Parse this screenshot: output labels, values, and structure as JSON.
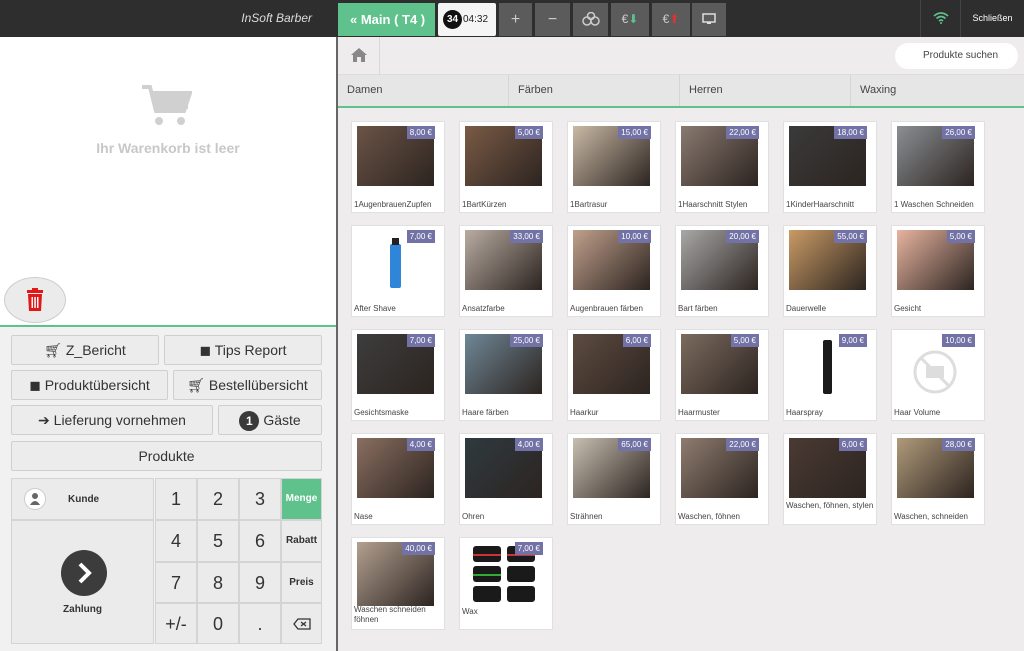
{
  "header": {
    "brand": "InSoft Barber",
    "main_tab": "« Main ( T4 )",
    "clock_badge": "34",
    "clock_time": "04:32",
    "tool_icons": [
      "plus-icon",
      "minus-icon",
      "split-icon",
      "euro-in-icon",
      "euro-out-icon",
      "monitor-icon"
    ],
    "close_label": "Schließen"
  },
  "cart": {
    "empty_text": "Ihr Warenkorb ist leer"
  },
  "actions": {
    "z_report": "Z_Bericht",
    "tips_report": "Tips Report",
    "product_overview": "Produktübersicht",
    "order_overview": "Bestellübersicht",
    "delivery": "Lieferung vornehmen",
    "guests_count": "1",
    "guests": "Gäste",
    "products": "Produkte"
  },
  "keypad": {
    "customer": "Kunde",
    "payment": "Zahlung",
    "keys": [
      "1",
      "2",
      "3",
      "4",
      "5",
      "6",
      "7",
      "8",
      "9",
      "+/-",
      "0",
      "."
    ],
    "side": [
      "Menge",
      "Rabatt",
      "Preis"
    ]
  },
  "search": {
    "placeholder": "Produkte suchen"
  },
  "categories": [
    "Damen",
    "Färben",
    "Herren",
    "Waxing"
  ],
  "products": [
    {
      "name": "1AugenbrauenZupfen",
      "price": "8,00 €"
    },
    {
      "name": "1BartKürzen",
      "price": "5,00 €"
    },
    {
      "name": "1Bartrasur",
      "price": "15,00 €"
    },
    {
      "name": "1Haarschnitt Stylen",
      "price": "22,00 €"
    },
    {
      "name": "1KinderHaarschnitt",
      "price": "18,00 €"
    },
    {
      "name": "1 Waschen Schneiden",
      "price": "26,00 €"
    },
    {
      "name": "After Shave",
      "price": "7,00 €"
    },
    {
      "name": "Ansatzfarbe",
      "price": "33,00 €"
    },
    {
      "name": "Augenbrauen färben",
      "price": "10,00 €"
    },
    {
      "name": "Bart färben",
      "price": "20,00 €"
    },
    {
      "name": "Dauerwelle",
      "price": "55,00 €"
    },
    {
      "name": "Gesicht",
      "price": "5,00 €"
    },
    {
      "name": "Gesichtsmaske",
      "price": "7,00 €"
    },
    {
      "name": "Haare färben",
      "price": "25,00 €"
    },
    {
      "name": "Haarkur",
      "price": "6,00 €"
    },
    {
      "name": "Haarmuster",
      "price": "5,00 €"
    },
    {
      "name": "Haarspray",
      "price": "9,00 €"
    },
    {
      "name": "Haar Volume",
      "price": "10,00 €"
    },
    {
      "name": "Nase",
      "price": "4,00 €"
    },
    {
      "name": "Ohren",
      "price": "4,00 €"
    },
    {
      "name": "Strähnen",
      "price": "65,00 €"
    },
    {
      "name": "Waschen, föhnen",
      "price": "22,00 €"
    },
    {
      "name": "Waschen, föhnen, stylen",
      "price": "6,00 €"
    },
    {
      "name": "Waschen, schneiden",
      "price": "28,00 €"
    },
    {
      "name": "Waschen schneiden föhnen",
      "price": "40,00 €"
    },
    {
      "name": "Wax",
      "price": "7,00 €"
    }
  ]
}
